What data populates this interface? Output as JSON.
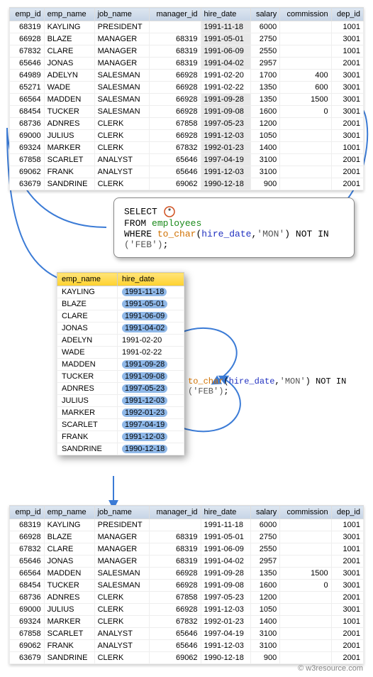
{
  "headers": [
    "emp_id",
    "emp_name",
    "job_name",
    "manager_id",
    "hire_date",
    "salary",
    "commission",
    "dep_id"
  ],
  "table1": [
    {
      "emp_id": 68319,
      "emp_name": "KAYLING",
      "job_name": "PRESIDENT",
      "manager_id": "",
      "hire_date": "1991-11-18",
      "salary": 6000,
      "commission": "",
      "dep_id": 1001,
      "hl": true
    },
    {
      "emp_id": 66928,
      "emp_name": "BLAZE",
      "job_name": "MANAGER",
      "manager_id": 68319,
      "hire_date": "1991-05-01",
      "salary": 2750,
      "commission": "",
      "dep_id": 3001,
      "hl": true
    },
    {
      "emp_id": 67832,
      "emp_name": "CLARE",
      "job_name": "MANAGER",
      "manager_id": 68319,
      "hire_date": "1991-06-09",
      "salary": 2550,
      "commission": "",
      "dep_id": 1001,
      "hl": true
    },
    {
      "emp_id": 65646,
      "emp_name": "JONAS",
      "job_name": "MANAGER",
      "manager_id": 68319,
      "hire_date": "1991-04-02",
      "salary": 2957,
      "commission": "",
      "dep_id": 2001,
      "hl": true
    },
    {
      "emp_id": 64989,
      "emp_name": "ADELYN",
      "job_name": "SALESMAN",
      "manager_id": 66928,
      "hire_date": "1991-02-20",
      "salary": 1700,
      "commission": 400,
      "dep_id": 3001,
      "hl": false
    },
    {
      "emp_id": 65271,
      "emp_name": "WADE",
      "job_name": "SALESMAN",
      "manager_id": 66928,
      "hire_date": "1991-02-22",
      "salary": 1350,
      "commission": 600,
      "dep_id": 3001,
      "hl": false
    },
    {
      "emp_id": 66564,
      "emp_name": "MADDEN",
      "job_name": "SALESMAN",
      "manager_id": 66928,
      "hire_date": "1991-09-28",
      "salary": 1350,
      "commission": 1500,
      "dep_id": 3001,
      "hl": true
    },
    {
      "emp_id": 68454,
      "emp_name": "TUCKER",
      "job_name": "SALESMAN",
      "manager_id": 66928,
      "hire_date": "1991-09-08",
      "salary": 1600,
      "commission": 0,
      "dep_id": 3001,
      "hl": true
    },
    {
      "emp_id": 68736,
      "emp_name": "ADNRES",
      "job_name": "CLERK",
      "manager_id": 67858,
      "hire_date": "1997-05-23",
      "salary": 1200,
      "commission": "",
      "dep_id": 2001,
      "hl": true
    },
    {
      "emp_id": 69000,
      "emp_name": "JULIUS",
      "job_name": "CLERK",
      "manager_id": 66928,
      "hire_date": "1991-12-03",
      "salary": 1050,
      "commission": "",
      "dep_id": 3001,
      "hl": true
    },
    {
      "emp_id": 69324,
      "emp_name": "MARKER",
      "job_name": "CLERK",
      "manager_id": 67832,
      "hire_date": "1992-01-23",
      "salary": 1400,
      "commission": "",
      "dep_id": 1001,
      "hl": true
    },
    {
      "emp_id": 67858,
      "emp_name": "SCARLET",
      "job_name": "ANALYST",
      "manager_id": 65646,
      "hire_date": "1997-04-19",
      "salary": 3100,
      "commission": "",
      "dep_id": 2001,
      "hl": true
    },
    {
      "emp_id": 69062,
      "emp_name": "FRANK",
      "job_name": "ANALYST",
      "manager_id": 65646,
      "hire_date": "1991-12-03",
      "salary": 3100,
      "commission": "",
      "dep_id": 2001,
      "hl": true
    },
    {
      "emp_id": 63679,
      "emp_name": "SANDRINE",
      "job_name": "CLERK",
      "manager_id": 69062,
      "hire_date": "1990-12-18",
      "salary": 900,
      "commission": "",
      "dep_id": 2001,
      "hl": true
    }
  ],
  "sql": {
    "select": "SELECT",
    "star": "*",
    "from": "FROM",
    "table": "employees",
    "where": "WHERE",
    "fn": "to_char",
    "col": "hire_date",
    "fmt": "'MON'",
    "notin": "NOT IN",
    "val": "('FEB')",
    "semi": ";"
  },
  "mini_headers": [
    "emp_name",
    "hire_date"
  ],
  "mini": [
    {
      "emp_name": "KAYLING",
      "hire_date": "1991-11-18",
      "hl": true
    },
    {
      "emp_name": "BLAZE",
      "hire_date": "1991-05-01",
      "hl": true
    },
    {
      "emp_name": "CLARE",
      "hire_date": "1991-06-09",
      "hl": true
    },
    {
      "emp_name": "JONAS",
      "hire_date": "1991-04-02",
      "hl": true
    },
    {
      "emp_name": "ADELYN",
      "hire_date": "1991-02-20",
      "hl": false
    },
    {
      "emp_name": "WADE",
      "hire_date": "1991-02-22",
      "hl": false
    },
    {
      "emp_name": "MADDEN",
      "hire_date": "1991-09-28",
      "hl": true
    },
    {
      "emp_name": "TUCKER",
      "hire_date": "1991-09-08",
      "hl": true
    },
    {
      "emp_name": "ADNRES",
      "hire_date": "1997-05-23",
      "hl": true
    },
    {
      "emp_name": "JULIUS",
      "hire_date": "1991-12-03",
      "hl": true
    },
    {
      "emp_name": "MARKER",
      "hire_date": "1992-01-23",
      "hl": true
    },
    {
      "emp_name": "SCARLET",
      "hire_date": "1997-04-19",
      "hl": true
    },
    {
      "emp_name": "FRANK",
      "hire_date": "1991-12-03",
      "hl": true
    },
    {
      "emp_name": "SANDRINE",
      "hire_date": "1990-12-18",
      "hl": true
    }
  ],
  "expr": {
    "fn": "to_char",
    "col": "hire_date",
    "fmt": "'MON'",
    "notin": "NOT IN",
    "val": "('FEB')",
    "semi": ";"
  },
  "table2": [
    {
      "emp_id": 68319,
      "emp_name": "KAYLING",
      "job_name": "PRESIDENT",
      "manager_id": "",
      "hire_date": "1991-11-18",
      "salary": 6000,
      "commission": "",
      "dep_id": 1001
    },
    {
      "emp_id": 66928,
      "emp_name": "BLAZE",
      "job_name": "MANAGER",
      "manager_id": 68319,
      "hire_date": "1991-05-01",
      "salary": 2750,
      "commission": "",
      "dep_id": 3001
    },
    {
      "emp_id": 67832,
      "emp_name": "CLARE",
      "job_name": "MANAGER",
      "manager_id": 68319,
      "hire_date": "1991-06-09",
      "salary": 2550,
      "commission": "",
      "dep_id": 1001
    },
    {
      "emp_id": 65646,
      "emp_name": "JONAS",
      "job_name": "MANAGER",
      "manager_id": 68319,
      "hire_date": "1991-04-02",
      "salary": 2957,
      "commission": "",
      "dep_id": 2001
    },
    {
      "emp_id": 66564,
      "emp_name": "MADDEN",
      "job_name": "SALESMAN",
      "manager_id": 66928,
      "hire_date": "1991-09-28",
      "salary": 1350,
      "commission": 1500,
      "dep_id": 3001
    },
    {
      "emp_id": 68454,
      "emp_name": "TUCKER",
      "job_name": "SALESMAN",
      "manager_id": 66928,
      "hire_date": "1991-09-08",
      "salary": 1600,
      "commission": 0,
      "dep_id": 3001
    },
    {
      "emp_id": 68736,
      "emp_name": "ADNRES",
      "job_name": "CLERK",
      "manager_id": 67858,
      "hire_date": "1997-05-23",
      "salary": 1200,
      "commission": "",
      "dep_id": 2001
    },
    {
      "emp_id": 69000,
      "emp_name": "JULIUS",
      "job_name": "CLERK",
      "manager_id": 66928,
      "hire_date": "1991-12-03",
      "salary": 1050,
      "commission": "",
      "dep_id": 3001
    },
    {
      "emp_id": 69324,
      "emp_name": "MARKER",
      "job_name": "CLERK",
      "manager_id": 67832,
      "hire_date": "1992-01-23",
      "salary": 1400,
      "commission": "",
      "dep_id": 1001
    },
    {
      "emp_id": 67858,
      "emp_name": "SCARLET",
      "job_name": "ANALYST",
      "manager_id": 65646,
      "hire_date": "1997-04-19",
      "salary": 3100,
      "commission": "",
      "dep_id": 2001
    },
    {
      "emp_id": 69062,
      "emp_name": "FRANK",
      "job_name": "ANALYST",
      "manager_id": 65646,
      "hire_date": "1991-12-03",
      "salary": 3100,
      "commission": "",
      "dep_id": 2001
    },
    {
      "emp_id": 63679,
      "emp_name": "SANDRINE",
      "job_name": "CLERK",
      "manager_id": 69062,
      "hire_date": "1990-12-18",
      "salary": 900,
      "commission": "",
      "dep_id": 2001
    }
  ],
  "watermark": "© w3resource.com"
}
